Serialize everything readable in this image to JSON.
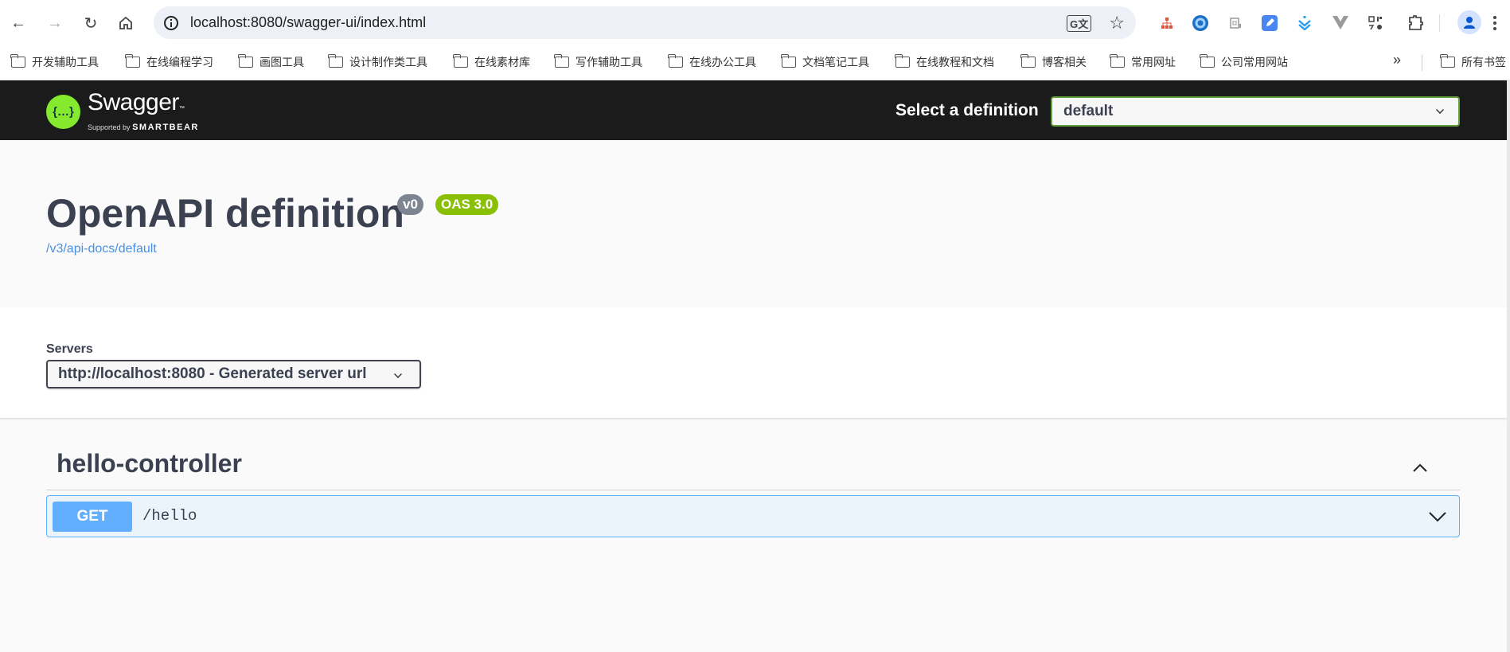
{
  "browser": {
    "url": "localhost:8080/swagger-ui/index.html",
    "nav_icons": [
      "back-arrow-icon",
      "forward-arrow-icon",
      "reload-icon",
      "home-icon"
    ],
    "extensions": [
      "translate-icon",
      "bookmark-star-icon",
      "sitemap-extension-icon",
      "ie-extension-icon",
      "dict-extension-icon",
      "note-extension-icon",
      "download-extension-icon",
      "vue-devtools-icon",
      "qr-code-icon",
      "extensions-puzzle-icon",
      "profile-avatar-icon",
      "menu-kebab-icon"
    ]
  },
  "bookmarks": {
    "items": [
      {
        "label": "开发辅助工具"
      },
      {
        "label": "在线编程学习"
      },
      {
        "label": "画图工具"
      },
      {
        "label": "设计制作类工具"
      },
      {
        "label": "在线素材库"
      },
      {
        "label": "写作辅助工具"
      },
      {
        "label": "在线办公工具"
      },
      {
        "label": "文档笔记工具"
      },
      {
        "label": "在线教程和文档"
      },
      {
        "label": "博客相关"
      },
      {
        "label": "常用网址"
      },
      {
        "label": "公司常用网站"
      }
    ],
    "overflow_label": "»",
    "all_bookmarks": "所有书签"
  },
  "topbar": {
    "logo_icon_text": "{…}",
    "logo_name": "Swagger",
    "logo_tm": "™",
    "logo_sub": "Supported by",
    "logo_brand": "SMARTBEAR",
    "definition_label": "Select a definition",
    "definition_value": "default",
    "accent": "#85ea2d"
  },
  "info": {
    "title": "OpenAPI definition",
    "version_badge": "v0",
    "oas_badge": "OAS 3.0",
    "spec_link": "/v3/api-docs/default",
    "version_color": "#7d8492",
    "oas_color": "#89bf04"
  },
  "servers": {
    "label": "Servers",
    "selected": "http://localhost:8080 - Generated server url"
  },
  "tags": [
    {
      "name": "hello-controller",
      "expanded": true,
      "operations": [
        {
          "method": "GET",
          "path": "/hello",
          "color": "#61affe"
        }
      ]
    }
  ]
}
